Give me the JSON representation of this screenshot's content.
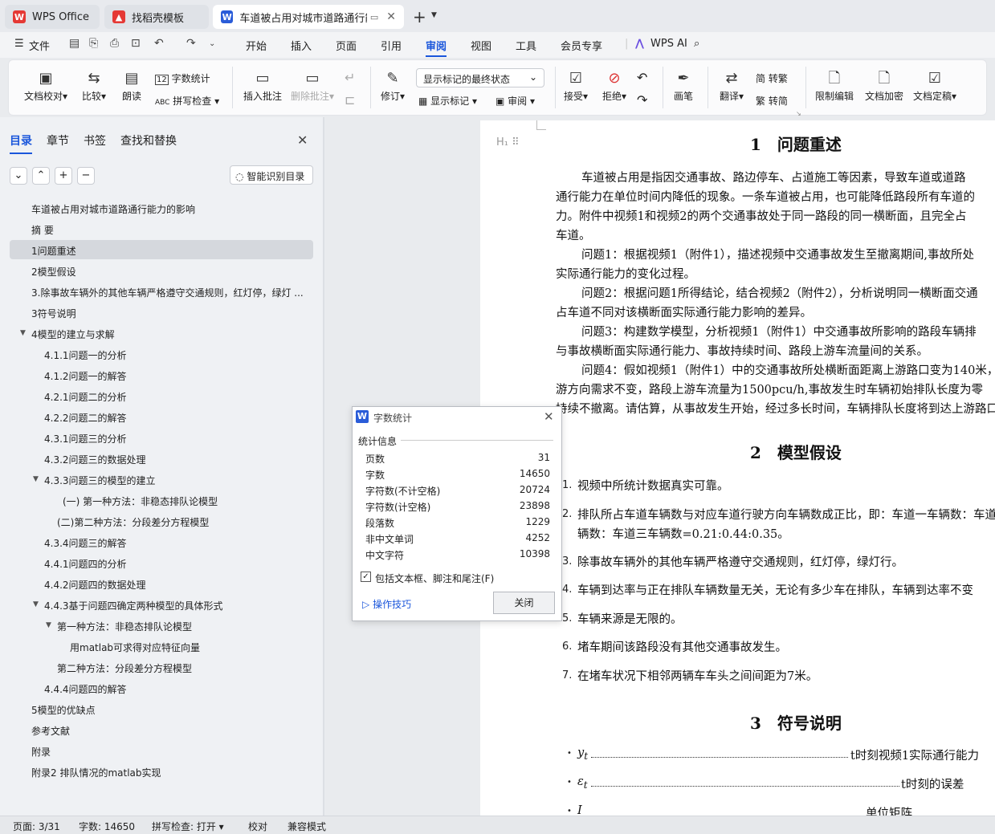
{
  "tabs": {
    "wps": "WPS Office",
    "find": "找稻壳模板",
    "doc": "车道被占用对城市道路通行能力的影响"
  },
  "menu": {
    "file": "文件",
    "items": [
      "开始",
      "插入",
      "页面",
      "引用",
      "审阅",
      "视图",
      "工具",
      "会员专享"
    ],
    "ai": "WPS AI",
    "active": "审阅"
  },
  "ribbon": {
    "proofread": "文档校对",
    "compare": "比较",
    "read": "朗读",
    "wordcount": "字数统计",
    "spellcheck": "拼写检查",
    "insert_comment": "插入批注",
    "delete_comment": "删除批注",
    "revise": "修订",
    "markup_mode": "显示标记的最终状态",
    "show_markup": "显示标记",
    "review": "审阅",
    "accept": "接受",
    "reject": "拒绝",
    "pen": "画笔",
    "translate": "翻译",
    "trad": "简 转繁",
    "simp": "繁 转简",
    "restrict": "限制编辑",
    "encrypt": "文档加密",
    "finalize": "文档定稿"
  },
  "nav": {
    "tabs": [
      "目录",
      "章节",
      "书签",
      "查找和替换"
    ],
    "smart": "智能识别目录",
    "items": [
      "车道被占用对城市道路通行能力的影响",
      "摘 要",
      "1问题重述",
      "2模型假设",
      "3.除事故车辆外的其他车辆严格遵守交通规则，红灯停，绿灯 ...",
      "3符号说明",
      "4模型的建立与求解",
      "4.1.1问题一的分析",
      "4.1.2问题一的解答",
      "4.2.1问题二的分析",
      "4.2.2问题二的解答",
      "4.3.1问题三的分析",
      "4.3.2问题三的数据处理",
      "4.3.3问题三的模型的建立",
      "(一) 第一种方法：非稳态排队论模型",
      "(二)第二种方法：分段差分方程模型",
      "4.3.4问题三的解答",
      "4.4.1问题四的分析",
      "4.4.2问题四的数据处理",
      "4.4.3基于问题四确定两种模型的具体形式",
      "第一种方法：非稳态排队论模型",
      "用matlab可求得对应特征向量",
      "第二种方法：分段差分方程模型",
      "4.4.4问题四的解答",
      "5模型的优缺点",
      "参考文献",
      "附录",
      "附录2 排队情况的matlab实现"
    ]
  },
  "doc": {
    "h1": "1　问题重述",
    "p1": [
      "车道被占用是指因交通事故、路边停车、占道施工等因素，导致车道或道路",
      "通行能力在单位时间内降低的现象。一条车道被占用，也可能降低路段所有车道的",
      "力。附件中视频1和视频2的两个交通事故处于同一路段的同一横断面，且完全占",
      "车道。"
    ],
    "q1": [
      "问题1：根据视频1（附件1），描述视频中交通事故发生至撤离期间,事故所处",
      "实际通行能力的变化过程。"
    ],
    "q2": [
      "问题2：根据问题1所得结论，结合视频2（附件2），分析说明同一横断面交通",
      "占车道不同对该横断面实际通行能力影响的差异。"
    ],
    "q3": [
      "问题3：构建数学模型，分析视频1（附件1）中交通事故所影响的路段车辆排",
      "与事故横断面实际通行能力、事故持续时间、路段上游车流量间的关系。"
    ],
    "q4": [
      "问题4：假如视频1（附件1）中的交通事故所处横断面距离上游路口变为140米，",
      "游方向需求不变，路段上游车流量为1500pcu/h,事故发生时车辆初始排队长度为零",
      "持续不撤离。请估算，从事故发生开始，经过多长时间，车辆排队长度将到达上游路口。"
    ],
    "h2": "2　模型假设",
    "assumptions": [
      "视频中所统计数据真实可靠。",
      "排队所占车道车辆数与对应车道行驶方向车辆数成正比，即：车道一车辆数：车道",
      "辆数：车道三车辆数=0.21:0.44:0.35。",
      "除事故车辆外的其他车辆严格遵守交通规则，红灯停，绿灯行。",
      "车辆到达率与正在排队车辆数量无关，无论有多少车在排队，车辆到达率不变",
      "车辆来源是无限的。",
      "堵车期间该路段没有其他交通事故发生。",
      "在堵车状况下相邻两辆车车头之间间距为7米。"
    ],
    "nums": [
      "1.",
      "2.",
      "3.",
      "4.",
      "5.",
      "6.",
      "7."
    ],
    "h3": "3　符号说明",
    "sym1": "y",
    "sym1s": "t",
    "sym1d": "t时刻视频1实际通行能力",
    "sym2": "ε",
    "sym2s": "t",
    "sym2d": "t时刻的误差",
    "sym3": "I",
    "sym3d": "单位矩阵"
  },
  "dialog": {
    "title": "字数统计",
    "section": "统计信息",
    "rows": [
      {
        "k": "页数",
        "v": "31"
      },
      {
        "k": "字数",
        "v": "14650"
      },
      {
        "k": "字符数(不计空格)",
        "v": "20724"
      },
      {
        "k": "字符数(计空格)",
        "v": "23898"
      },
      {
        "k": "段落数",
        "v": "1229"
      },
      {
        "k": "非中文单词",
        "v": "4252"
      },
      {
        "k": "中文字符",
        "v": "10398"
      }
    ],
    "checkbox": "包括文本框、脚注和尾注(F)",
    "tips": "操作技巧",
    "close": "关闭"
  },
  "status": {
    "page": "页面: 3/31",
    "words": "字数: 14650",
    "spell": "拼写检查: 打开",
    "proof": "校对",
    "compat": "兼容模式"
  },
  "colors": {
    "accent": "#1a56db",
    "brand_red": "#e53935",
    "tab_blue": "#2a5cd8"
  }
}
